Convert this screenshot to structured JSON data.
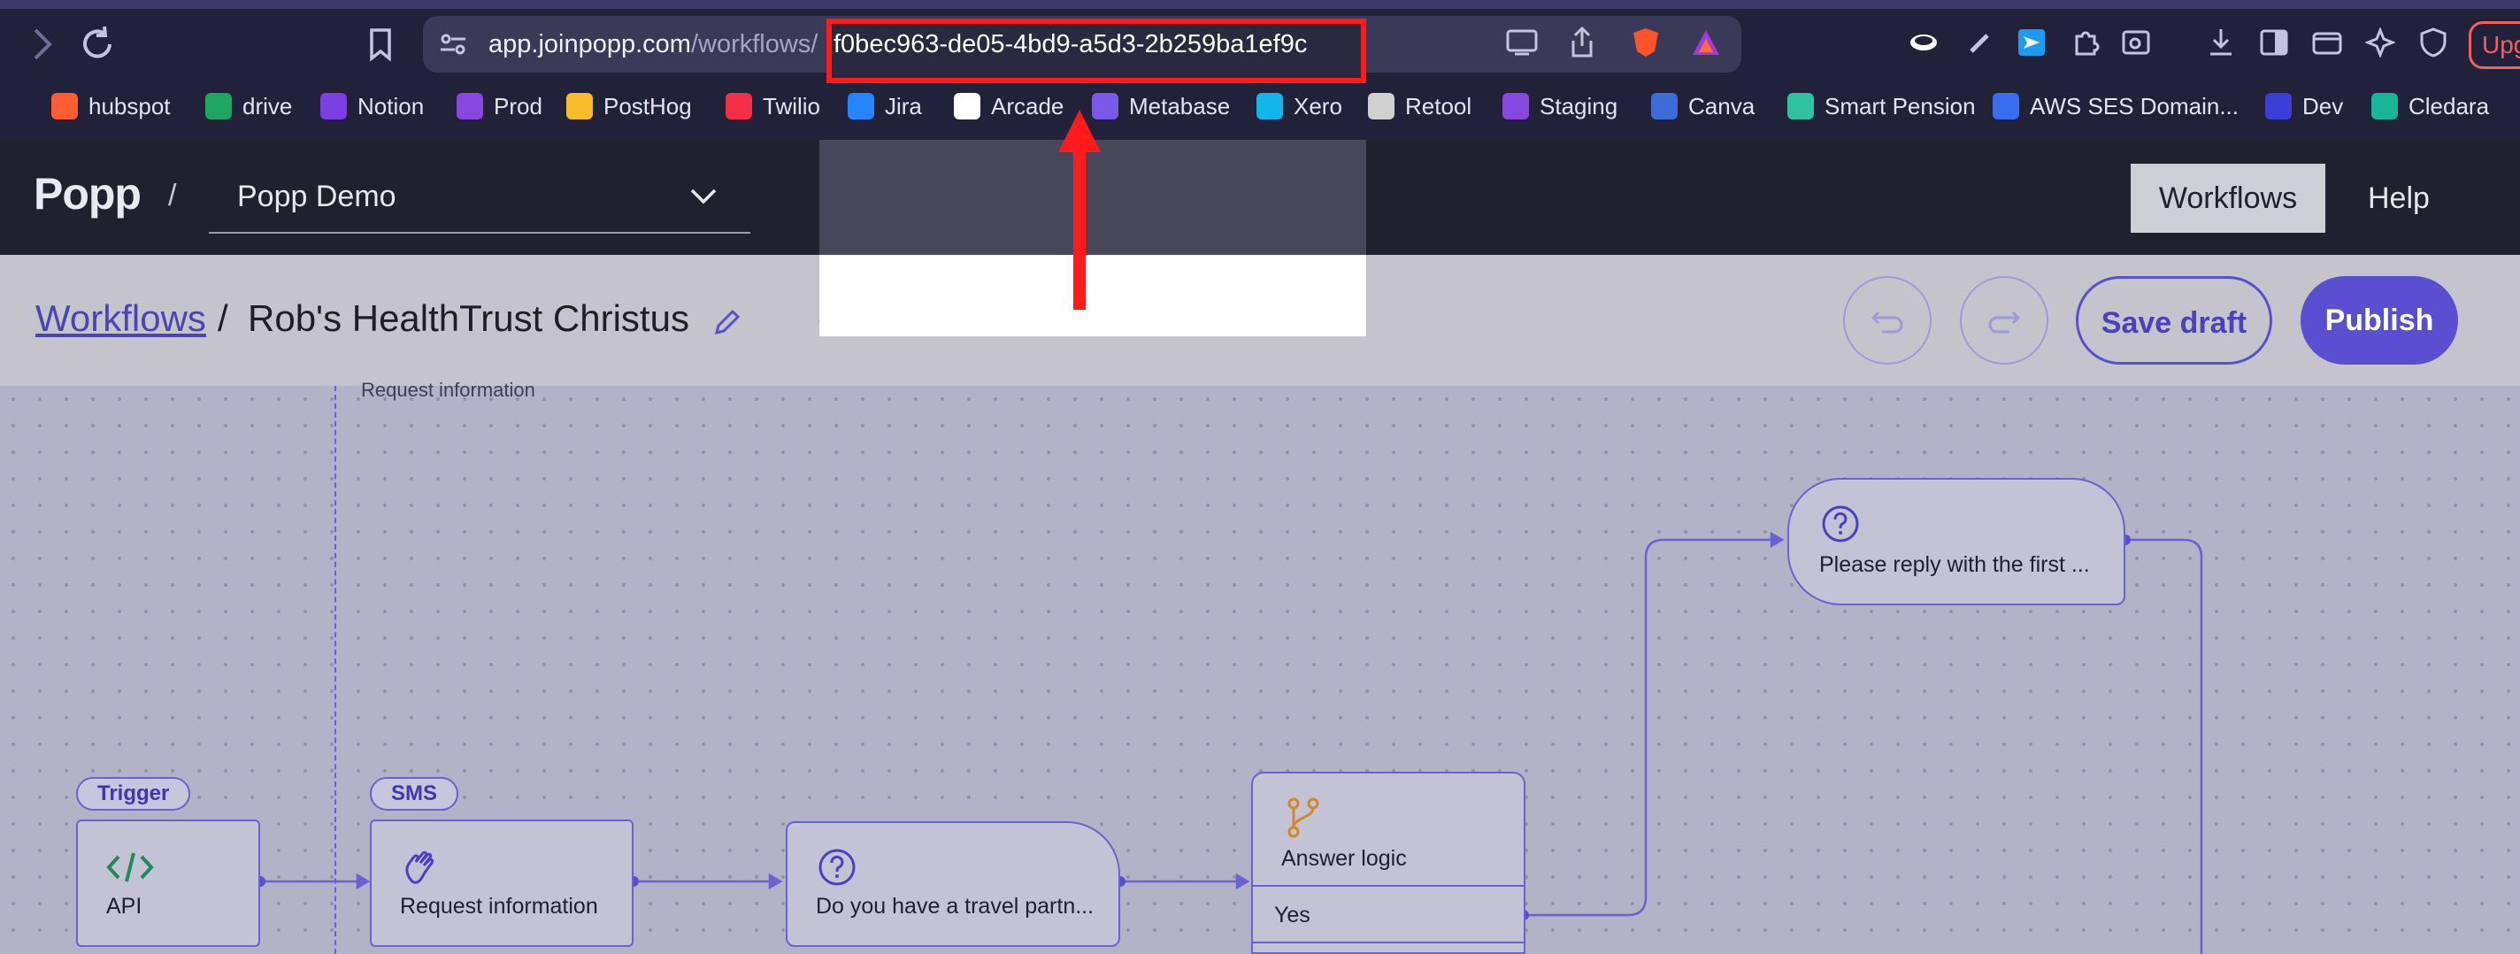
{
  "browser": {
    "url_host": "app.joinpopp.com",
    "url_path": "/workflows/",
    "url_highlight": "f0bec963-de05-4bd9-a5d3-2b259ba1ef9c",
    "upgrade_label": "Upg",
    "bookmarks": [
      {
        "label": "hubspot",
        "icon": "hubspot-icon",
        "color": "#ff5c35"
      },
      {
        "label": "drive",
        "icon": "google-drive-icon",
        "color": "#1fa463"
      },
      {
        "label": "Notion",
        "icon": "notion-icon",
        "color": "#7b3fe4"
      },
      {
        "label": "Prod",
        "icon": "prod-p-icon",
        "color": "#8848e0"
      },
      {
        "label": "PostHog",
        "icon": "posthog-icon",
        "color": "#f9bd2b"
      },
      {
        "label": "Twilio",
        "icon": "twilio-icon",
        "color": "#f22f46"
      },
      {
        "label": "Jira",
        "icon": "jira-icon",
        "color": "#2684ff"
      },
      {
        "label": "Arcade",
        "icon": "arcade-icon",
        "color": "#ffffff"
      },
      {
        "label": "Metabase",
        "icon": "metabase-icon",
        "color": "#7a58e8"
      },
      {
        "label": "Xero",
        "icon": "xero-icon",
        "color": "#13b5ea"
      },
      {
        "label": "Retool",
        "icon": "retool-icon",
        "color": "#d0d0d0"
      },
      {
        "label": "Staging",
        "icon": "staging-p-icon",
        "color": "#8848e0"
      },
      {
        "label": "Canva",
        "icon": "canva-icon",
        "color": "#3d6cd8"
      },
      {
        "label": "Smart Pension",
        "icon": "smart-pension-icon",
        "color": "#2fc1a0"
      },
      {
        "label": "AWS SES Domain...",
        "icon": "aws-icon",
        "color": "#3b6df0"
      },
      {
        "label": "Dev",
        "icon": "dev-p-icon",
        "color": "#3b3fd8"
      },
      {
        "label": "Cledara",
        "icon": "cledara-icon",
        "color": "#19b59a"
      }
    ]
  },
  "app": {
    "logo": "Popp",
    "separator": "/",
    "project": "Popp Demo",
    "nav": {
      "workflows": "Workflows",
      "help": "Help"
    }
  },
  "subheader": {
    "breadcrumb_root": "Workflows",
    "breadcrumb_sep": "/",
    "title": "Rob's HealthTrust Christus",
    "save_draft": "Save draft",
    "publish": "Publish"
  },
  "canvas": {
    "lane_label": "Request information",
    "tags": {
      "trigger": "Trigger",
      "sms": "SMS"
    },
    "nodes": {
      "api": "API",
      "request": "Request information",
      "travel": "Do you have a travel partn...",
      "answer_logic": "Answer logic",
      "answer_yes": "Yes",
      "reply": "Please reply with the first ..."
    }
  },
  "colors": {
    "accent": "#5a4fd0",
    "annotation_red": "#ff1b1b"
  }
}
